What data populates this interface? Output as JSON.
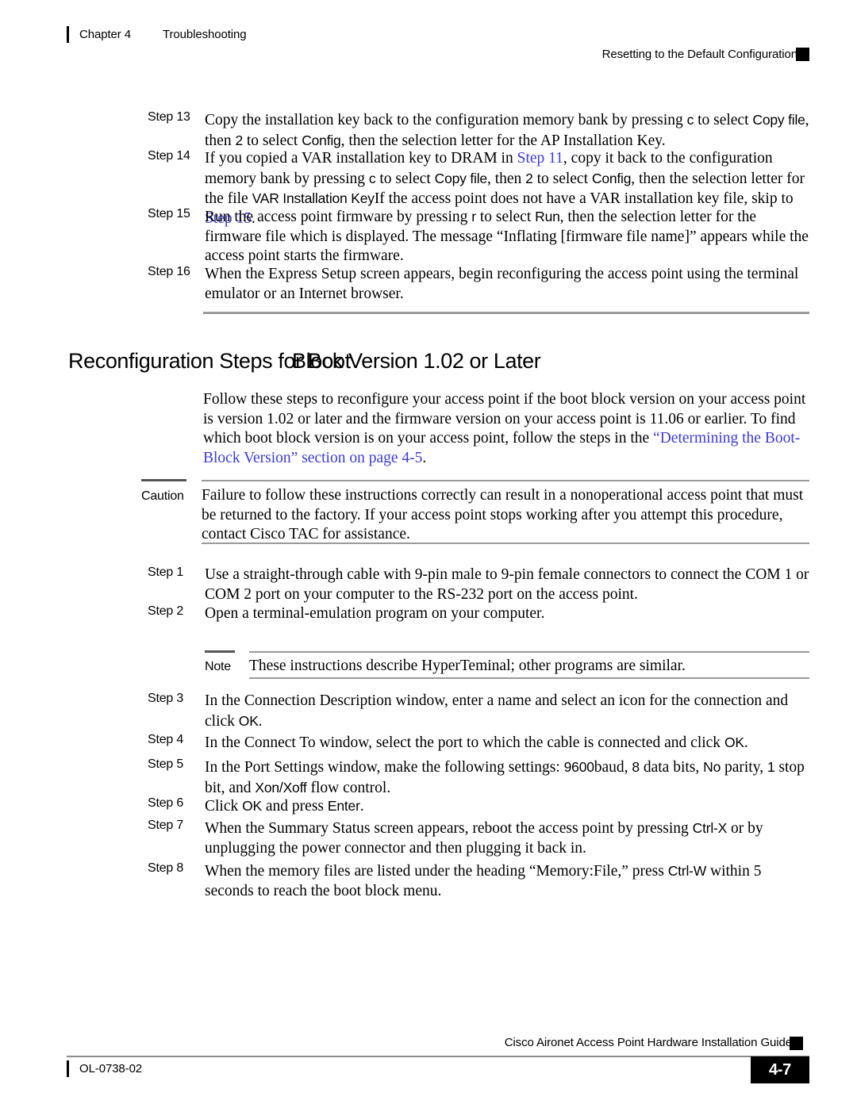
{
  "header": {
    "chapter": "Chapter 4",
    "topic": "Troubleshooting",
    "section": "Resetting to the Default Configuration"
  },
  "steps_top": [
    {
      "label": "Step 13",
      "segments": [
        {
          "text": "Copy the installation key back to the configuration memory bank by pressing ",
          "style": "serif"
        },
        {
          "text": "c",
          "style": "cmd"
        },
        {
          "text": " to select ",
          "style": "serif"
        },
        {
          "text": "Copy file",
          "style": "cmd"
        },
        {
          "text": ", then ",
          "style": "serif"
        },
        {
          "text": "2",
          "style": "cmd"
        },
        {
          "text": " to select ",
          "style": "serif"
        },
        {
          "text": "Config",
          "style": "cmd"
        },
        {
          "text": ", then the selection letter for the AP Installation Key.",
          "style": "serif"
        }
      ]
    },
    {
      "label": "Step 14",
      "segments": [
        {
          "text": "If you copied a VAR installation key to DRAM in ",
          "style": "serif"
        },
        {
          "text": "Step 11",
          "style": "link"
        },
        {
          "text": ", copy it back to the configuration memory bank by pressing ",
          "style": "serif"
        },
        {
          "text": "c",
          "style": "cmd"
        },
        {
          "text": " to select ",
          "style": "serif"
        },
        {
          "text": "Copy file",
          "style": "cmd"
        },
        {
          "text": ", then ",
          "style": "serif"
        },
        {
          "text": "2",
          "style": "cmd"
        },
        {
          "text": " to select ",
          "style": "serif"
        },
        {
          "text": "Config",
          "style": "cmd"
        },
        {
          "text": ", then the selection letter for the file ",
          "style": "serif"
        },
        {
          "text": "VAR Installation Key",
          "style": "cmd"
        },
        {
          "text": "If the access point does not have a VAR installation key file, skip to ",
          "style": "serif"
        },
        {
          "text": "Step 15",
          "style": "link"
        },
        {
          "text": ".",
          "style": "serif"
        }
      ]
    },
    {
      "label": "Step 15",
      "segments": [
        {
          "text": "Run the access point firmware by pressing ",
          "style": "serif"
        },
        {
          "text": "r",
          "style": "cmd"
        },
        {
          "text": " to select ",
          "style": "serif"
        },
        {
          "text": "Run",
          "style": "cmd"
        },
        {
          "text": ", then the selection letter for the firmware file which is displayed. The message “Inflating [firmware file name]” appears while the access point starts the firmware.",
          "style": "serif"
        }
      ]
    },
    {
      "label": "Step 16",
      "segments": [
        {
          "text": "When the Express Setup screen appears, begin reconfiguring the access point using the terminal emulator or an Internet browser.",
          "style": "serif"
        }
      ]
    }
  ],
  "section_heading": {
    "base": "Reconfiguration Steps for Boot",
    "overlap": "Block Version 1.02 or Later",
    "full": "Reconfiguration Steps for Boot Block Version 1.02 or Later"
  },
  "intro": {
    "segments": [
      {
        "text": "Follow these steps to reconfigure your access point if the boot block version on your access point is version 1.02 or later and the firmware version on your access point is 11.06 or earlier. To find which boot block version is on your access point, follow the steps in the ",
        "style": "serif"
      },
      {
        "text": "“Determining the Boot-Block Version” section on page 4-5",
        "style": "link"
      },
      {
        "text": ".",
        "style": "serif"
      }
    ]
  },
  "caution": {
    "tag": "Caution",
    "text": "Failure to follow these instructions correctly can result in a nonoperational access point that must be returned to the factory. If your access point stops working after you attempt this procedure, contact Cisco TAC for assistance."
  },
  "note": {
    "tag": "Note",
    "text": "These instructions describe HyperTeminal; other programs are similar."
  },
  "steps_bottom": [
    {
      "label": "Step 1",
      "segments": [
        {
          "text": "Use a straight-through cable with 9-pin male to 9-pin female connectors to connect the COM 1 or COM 2 port on your computer to the RS-232 port on the access point.",
          "style": "serif"
        }
      ]
    },
    {
      "label": "Step 2",
      "segments": [
        {
          "text": "Open a terminal-emulation program on your computer.",
          "style": "serif"
        }
      ]
    },
    {
      "label": "Step 3",
      "segments": [
        {
          "text": "In the Connection Description window, enter a name and select an icon for the connection and click ",
          "style": "serif"
        },
        {
          "text": "OK",
          "style": "cmd"
        },
        {
          "text": ".",
          "style": "serif"
        }
      ]
    },
    {
      "label": "Step 4",
      "segments": [
        {
          "text": "In the Connect To window, select the port to which the cable is connected and click ",
          "style": "serif"
        },
        {
          "text": "OK",
          "style": "cmd"
        },
        {
          "text": ".",
          "style": "serif"
        }
      ]
    },
    {
      "label": "Step 5",
      "segments": [
        {
          "text": "In the Port Settings window, make the following settings: ",
          "style": "serif"
        },
        {
          "text": "9600",
          "style": "cmd"
        },
        {
          "text": "baud, ",
          "style": "serif"
        },
        {
          "text": "8",
          "style": "cmd"
        },
        {
          "text": " data bits, ",
          "style": "serif"
        },
        {
          "text": "No",
          "style": "cmd"
        },
        {
          "text": " parity, ",
          "style": "serif"
        },
        {
          "text": "1",
          "style": "cmd"
        },
        {
          "text": " stop bit, and ",
          "style": "serif"
        },
        {
          "text": "Xon/Xoff",
          "style": "cmd"
        },
        {
          "text": " flow control.",
          "style": "serif"
        }
      ]
    },
    {
      "label": "Step 6",
      "segments": [
        {
          "text": "Click ",
          "style": "serif"
        },
        {
          "text": "OK",
          "style": "cmd"
        },
        {
          "text": " and press ",
          "style": "serif"
        },
        {
          "text": "Enter",
          "style": "cmd"
        },
        {
          "text": ".",
          "style": "serif"
        }
      ]
    },
    {
      "label": "Step 7",
      "segments": [
        {
          "text": "When the Summary Status screen appears, reboot the access point by pressing ",
          "style": "serif"
        },
        {
          "text": "Ctrl-X",
          "style": "cmd"
        },
        {
          "text": " or by unplugging the power connector and then plugging it back in.",
          "style": "serif"
        }
      ]
    },
    {
      "label": "Step 8",
      "segments": [
        {
          "text": "When the memory files are listed under the heading “Memory:File,” press ",
          "style": "serif"
        },
        {
          "text": "Ctrl-W",
          "style": "cmd"
        },
        {
          "text": " within 5 seconds to reach the boot block menu.",
          "style": "serif"
        }
      ]
    }
  ],
  "footer": {
    "guide": "Cisco Aironet Access Point Hardware Installation Guide",
    "doc_id": "OL-0738-02",
    "page_number": "4-7"
  },
  "colors": {
    "link": "#3b3bd6",
    "rule_gray": "#9a9a9a",
    "page_box": "#000000"
  }
}
